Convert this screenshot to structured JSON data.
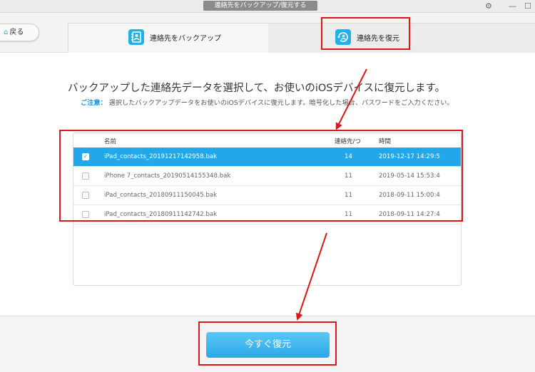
{
  "window": {
    "title": "連絡先をバックアップ/復元する",
    "gear_icon": "gear-icon",
    "minimize_icon": "minimize-icon",
    "maximize_icon": "maximize-icon"
  },
  "nav": {
    "back_label": "戻る",
    "back_icon": "home-icon"
  },
  "tabs": [
    {
      "label": "連絡先をバックアップ",
      "icon": "contacts-book-icon",
      "active": false
    },
    {
      "label": "連絡先を復元",
      "icon": "restore-contact-icon",
      "active": true
    }
  ],
  "main": {
    "headline": "バックアップした連絡先データを選択して、お使いのiOSデバイスに復元します。",
    "note_label": "ご注意：",
    "note_text": "選択したバックアップデータをお使いのiOSデバイスに復元します。暗号化した場合、パスワードをご入力ください。"
  },
  "table": {
    "columns": {
      "name": "名前",
      "count": "連絡先/つ",
      "time": "時間"
    },
    "rows": [
      {
        "name": "iPad_contacts_20191217142958.bak",
        "count": "14",
        "time": "2019-12-17 14:29:5",
        "checked": true
      },
      {
        "name": "iPhone 7_contacts_20190514155348.bak",
        "count": "11",
        "time": "2019-05-14 15:53:4",
        "checked": false
      },
      {
        "name": "iPad_contacts_20180911150045.bak",
        "count": "11",
        "time": "2018-09-11 15:00:4",
        "checked": false
      },
      {
        "name": "iPad_contacts_20180911142742.bak",
        "count": "11",
        "time": "2018-09-11 14:27:4",
        "checked": false
      }
    ]
  },
  "footer": {
    "restore_label": "今すぐ復元"
  },
  "colors": {
    "accent": "#22a7ea",
    "highlight_annotation": "#e01616"
  }
}
